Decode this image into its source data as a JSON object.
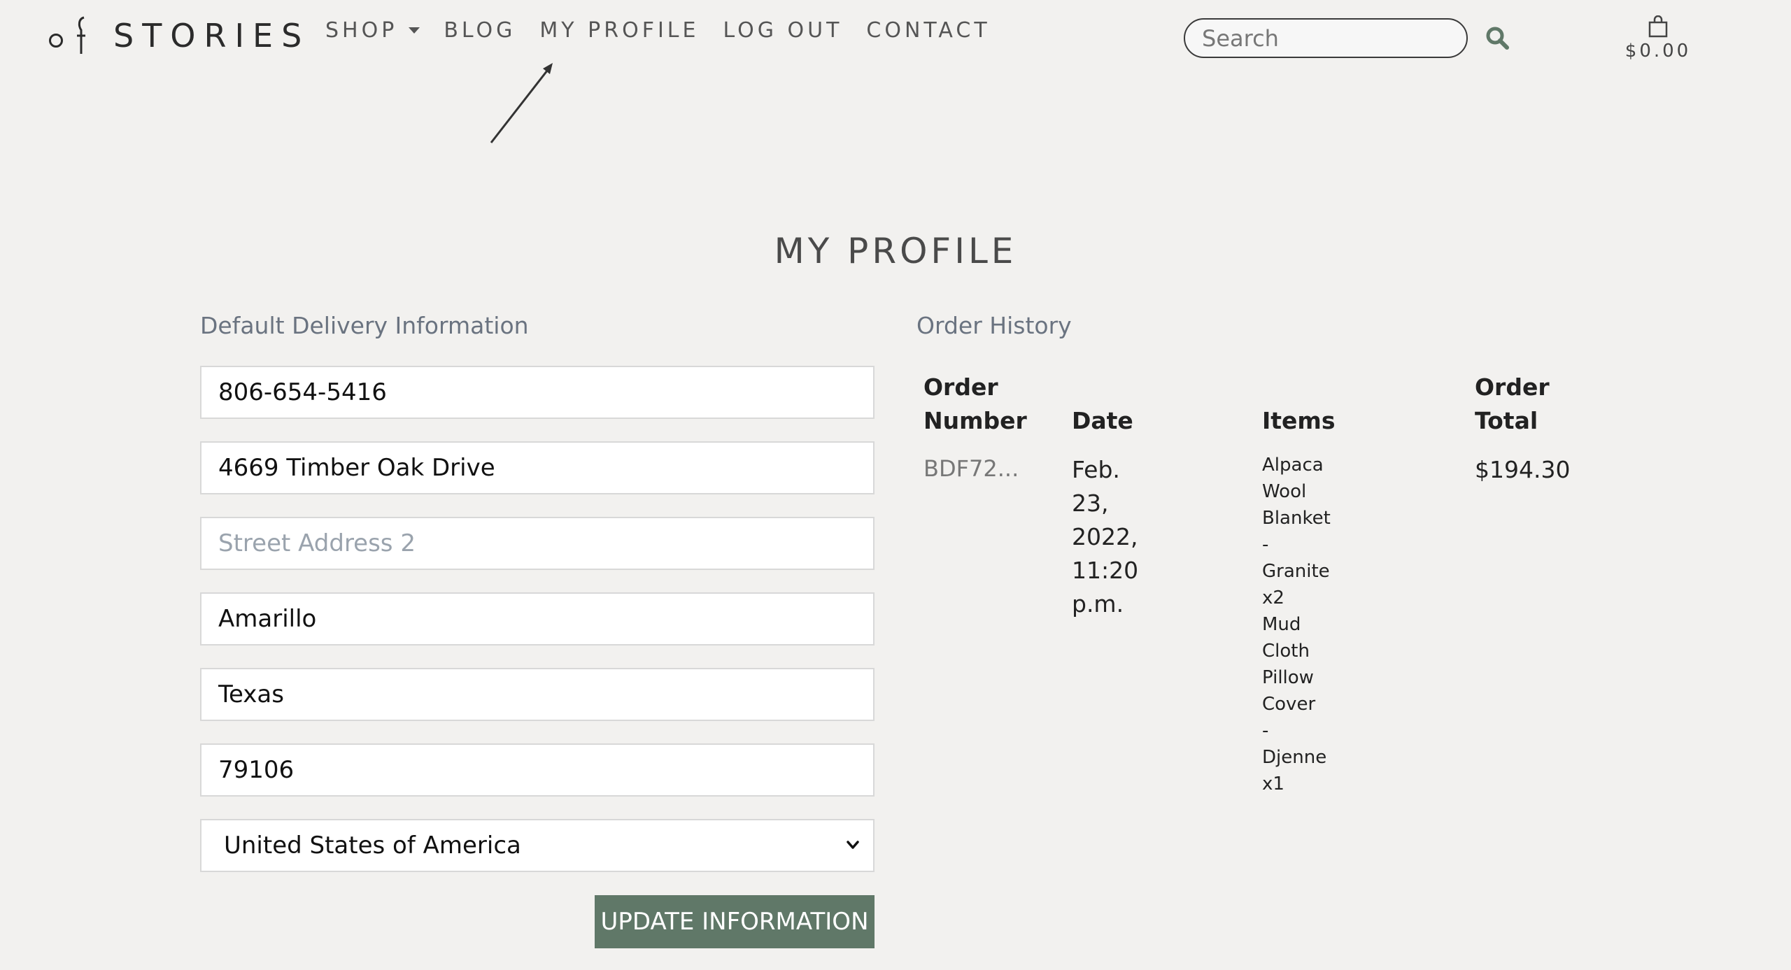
{
  "header": {
    "logo_text": "STORIES",
    "nav": [
      {
        "label": "SHOP",
        "has_dropdown": true
      },
      {
        "label": "BLOG"
      },
      {
        "label": "MY PROFILE"
      },
      {
        "label": "LOG OUT"
      },
      {
        "label": "CONTACT"
      }
    ],
    "search": {
      "placeholder": "Search",
      "value": ""
    },
    "cart_total": "$0.00"
  },
  "page": {
    "title": "MY PROFILE"
  },
  "delivery": {
    "title": "Default Delivery Information",
    "phone": "806-654-5416",
    "street1": "4669 Timber Oak Drive",
    "street2_placeholder": "Street Address 2",
    "city": "Amarillo",
    "county": "Texas",
    "postcode": "79106",
    "country": "United States of America",
    "submit_label": "UPDATE INFORMATION"
  },
  "orders": {
    "title": "Order History",
    "headers": {
      "number_1": "Order",
      "number_2": "Number",
      "date": "Date",
      "items": "Items",
      "total_1": "Order",
      "total_2": "Total"
    },
    "rows": [
      {
        "number": "BDF72...",
        "date_1": "Feb. 23, 2022,",
        "date_2": "11:20 p.m.",
        "items": [
          "Alpaca Wool Blanket -",
          "Granite x2",
          "Mud Cloth Pillow Cover",
          "- Djenne x1"
        ],
        "total": "$194.30"
      }
    ]
  },
  "colors": {
    "background": "#f2f1ef",
    "button": "#607868"
  }
}
